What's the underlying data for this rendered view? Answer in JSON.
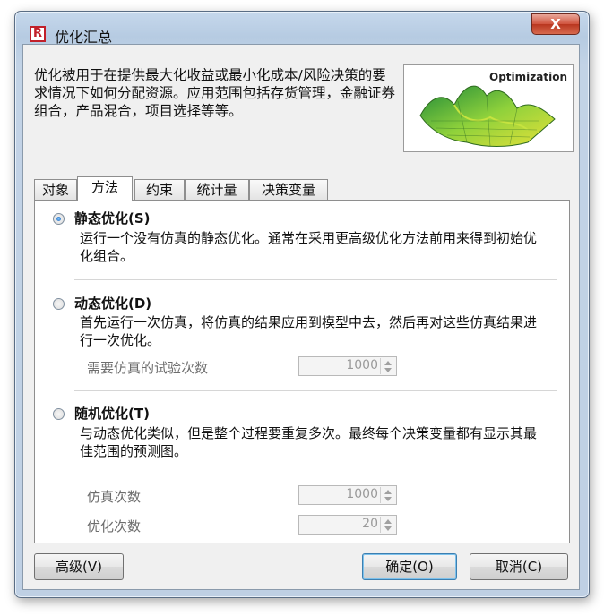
{
  "window": {
    "title": "优化汇总",
    "app_icon": "R",
    "close_label": "X"
  },
  "description": "优化被用于在提供最大化收益或最小化成本/风险决策的要求情况下如何分配资源。应用范围包括存货管理，金融证券组合，产品混合，项目选择等等。",
  "image": {
    "label": "Optimization",
    "icon": "3d-surface-plot"
  },
  "tabs": [
    {
      "label": "对象",
      "active": false
    },
    {
      "label": "方法",
      "active": true
    },
    {
      "label": "约束",
      "active": false
    },
    {
      "label": "统计量",
      "active": false
    },
    {
      "label": "决策变量",
      "active": false
    }
  ],
  "methods": {
    "static": {
      "title": "静态优化(S)",
      "selected": true,
      "text": "运行一个没有仿真的静态优化。通常在采用更高级优化方法前用来得到初始优化组合。"
    },
    "dynamic": {
      "title": "动态优化(D)",
      "selected": false,
      "text": "首先运行一次仿真，将仿真的结果应用到模型中去，然后再对这些仿真结果进行一次优化。",
      "trials_label": "需要仿真的试验次数",
      "trials_value": "1000"
    },
    "stochastic": {
      "title": "随机优化(T)",
      "selected": false,
      "text": "与动态优化类似，但是整个过程要重复多次。最终每个决策变量都有显示其最佳范围的预测图。",
      "simulations_label": "仿真次数",
      "simulations_value": "1000",
      "optimizations_label": "优化次数",
      "optimizations_value": "20"
    }
  },
  "buttons": {
    "advanced": "高级(V)",
    "ok": "确定(O)",
    "cancel": "取消(C)"
  }
}
